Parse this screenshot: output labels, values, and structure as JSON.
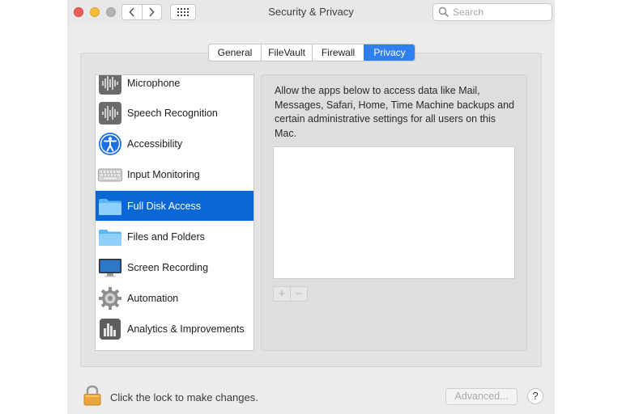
{
  "window": {
    "title": "Security & Privacy",
    "search_placeholder": "Search"
  },
  "tabs": [
    {
      "label": "General",
      "active": false
    },
    {
      "label": "FileVault",
      "active": false
    },
    {
      "label": "Firewall",
      "active": false
    },
    {
      "label": "Privacy",
      "active": true
    }
  ],
  "sidebar": {
    "items": [
      {
        "label": "Microphone",
        "icon": "microphone-waveform-icon",
        "selected": false
      },
      {
        "label": "Speech Recognition",
        "icon": "speech-waveform-icon",
        "selected": false
      },
      {
        "label": "Accessibility",
        "icon": "accessibility-person-icon",
        "selected": false
      },
      {
        "label": "Input Monitoring",
        "icon": "keyboard-icon",
        "selected": false
      },
      {
        "label": "Full Disk Access",
        "icon": "folder-icon",
        "selected": true
      },
      {
        "label": "Files and Folders",
        "icon": "folder-icon",
        "selected": false
      },
      {
        "label": "Screen Recording",
        "icon": "display-icon",
        "selected": false
      },
      {
        "label": "Automation",
        "icon": "gear-icon",
        "selected": false
      },
      {
        "label": "Analytics & Improvements",
        "icon": "bar-chart-icon",
        "selected": false
      }
    ]
  },
  "detail": {
    "description": "Allow the apps below to access data like Mail, Messages, Safari, Home, Time Machine backups and certain administrative settings for all users on this Mac.",
    "add_label": "+",
    "remove_label": "−"
  },
  "footer": {
    "lock_text": "Click the lock to make changes.",
    "advanced_label": "Advanced...",
    "help_label": "?"
  },
  "colors": {
    "accent": "#0b67d6",
    "tab_active": "#2f7ff0"
  }
}
